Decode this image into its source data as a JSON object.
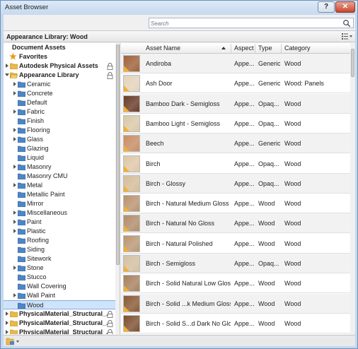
{
  "window": {
    "title": "Asset Browser",
    "help_label": "?",
    "close_label": "✕"
  },
  "search": {
    "placeholder": "Search"
  },
  "library_header": {
    "title": "Appearance Library: Wood"
  },
  "tree": {
    "document_assets": "Document Assets",
    "favorites": "Favorites",
    "autodesk_physical": "Autodesk Physical Assets",
    "appearance_library": "Appearance Library",
    "categories": [
      {
        "label": "Ceramic",
        "expandable": true
      },
      {
        "label": "Concrete",
        "expandable": true
      },
      {
        "label": "Default",
        "expandable": false
      },
      {
        "label": "Fabric",
        "expandable": true
      },
      {
        "label": "Finish",
        "expandable": false
      },
      {
        "label": "Flooring",
        "expandable": true
      },
      {
        "label": "Glass",
        "expandable": true
      },
      {
        "label": "Glazing",
        "expandable": false
      },
      {
        "label": "Liquid",
        "expandable": false
      },
      {
        "label": "Masonry",
        "expandable": true
      },
      {
        "label": "Masonry CMU",
        "expandable": false
      },
      {
        "label": "Metal",
        "expandable": true
      },
      {
        "label": "Metallic Paint",
        "expandable": false
      },
      {
        "label": "Mirror",
        "expandable": false
      },
      {
        "label": "Miscellaneous",
        "expandable": true
      },
      {
        "label": "Paint",
        "expandable": true
      },
      {
        "label": "Plastic",
        "expandable": true
      },
      {
        "label": "Roofing",
        "expandable": false
      },
      {
        "label": "Siding",
        "expandable": false
      },
      {
        "label": "Sitework",
        "expandable": false
      },
      {
        "label": "Stone",
        "expandable": true
      },
      {
        "label": "Stucco",
        "expandable": false
      },
      {
        "label": "Wall Covering",
        "expandable": false
      },
      {
        "label": "Wall Paint",
        "expandable": true
      },
      {
        "label": "Wood",
        "expandable": false,
        "selected": true
      }
    ],
    "physical_libraries": [
      "PhysicalMaterial_Structural_...",
      "PhysicalMaterial_Structural_...",
      "PhysicalMaterial_Structural_..."
    ]
  },
  "grid": {
    "columns": {
      "name": "Asset Name",
      "aspect": "Aspect",
      "type": "Type",
      "category": "Category"
    },
    "rows": [
      {
        "name": "Andiroba",
        "aspect": "Appe...",
        "type": "Generic",
        "category": "Wood",
        "swatch": "#a0623a"
      },
      {
        "name": "Ash Door",
        "aspect": "Appe...",
        "type": "Generic",
        "category": "Wood: Panels",
        "swatch": "#e2d3b9"
      },
      {
        "name": "Bamboo Dark - Semigloss",
        "aspect": "Appe...",
        "type": "Opaq...",
        "category": "Wood",
        "swatch": "#6a3b28"
      },
      {
        "name": "Bamboo Light - Semigloss",
        "aspect": "Appe...",
        "type": "Opaq...",
        "category": "Wood",
        "swatch": "#d9c7a6"
      },
      {
        "name": "Beech",
        "aspect": "Appe...",
        "type": "Generic",
        "category": "Wood",
        "swatch": "#c98d63"
      },
      {
        "name": "Birch",
        "aspect": "Appe...",
        "type": "Opaq...",
        "category": "Wood",
        "swatch": "#ddc6a6"
      },
      {
        "name": "Birch - Glossy",
        "aspect": "Appe...",
        "type": "Opaq...",
        "category": "Wood",
        "swatch": "#d6bd99"
      },
      {
        "name": "Birch - Natural Medium Gloss",
        "aspect": "Appe...",
        "type": "Wood",
        "category": "Wood",
        "swatch": "#b8926e"
      },
      {
        "name": "Birch - Natural No Gloss",
        "aspect": "Appe...",
        "type": "Wood",
        "category": "Wood",
        "swatch": "#b28d6b"
      },
      {
        "name": "Birch - Natural Polished",
        "aspect": "Appe...",
        "type": "Wood",
        "category": "Wood",
        "swatch": "#b99572"
      },
      {
        "name": "Birch - Semigloss",
        "aspect": "Appe...",
        "type": "Opaq...",
        "category": "Wood",
        "swatch": "#d5c0a2"
      },
      {
        "name": "Birch - Solid Natural Low Gloss",
        "aspect": "Appe...",
        "type": "Wood",
        "category": "Wood",
        "swatch": "#a7805d"
      },
      {
        "name": "Birch - Solid ...k Medium Gloss",
        "aspect": "Appe...",
        "type": "Wood",
        "category": "Wood",
        "swatch": "#8a5a36"
      },
      {
        "name": "Birch - Solid S...d Dark No Gloss",
        "aspect": "Appe...",
        "type": "Wood",
        "category": "Wood",
        "swatch": "#7d4e2e"
      }
    ]
  },
  "colors": {
    "folder": "#e9b949",
    "folder_blue": "#4e86c4",
    "selection": "#cfe3fa",
    "corner_tag": "#f4b02c"
  }
}
